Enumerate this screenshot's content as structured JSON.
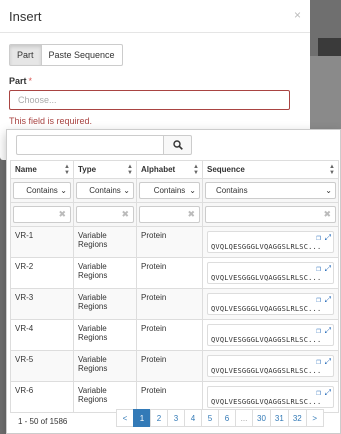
{
  "modal": {
    "title": "Insert",
    "close": "×",
    "mode_buttons": [
      "Part",
      "Paste Sequence"
    ],
    "field_label": "Part",
    "required_mark": "*",
    "placeholder": "Choose...",
    "error": "This field is required."
  },
  "table": {
    "columns": [
      "Name",
      "Type",
      "Alphabet",
      "Sequence"
    ],
    "filter_options": [
      "Contains",
      "Contains",
      "Contains",
      "Contains"
    ],
    "rows": [
      {
        "name": "VR-1",
        "type": "Variable Regions",
        "alphabet": "Protein",
        "sequence": "QVQLQESGGGLVQAGGSLRLSC..."
      },
      {
        "name": "VR-2",
        "type": "Variable Regions",
        "alphabet": "Protein",
        "sequence": "QVQLVESGGGLVQAGGSLRLSC..."
      },
      {
        "name": "VR-3",
        "type": "Variable Regions",
        "alphabet": "Protein",
        "sequence": "QVQLVESGGGLVQAGGSLRLSC..."
      },
      {
        "name": "VR-4",
        "type": "Variable Regions",
        "alphabet": "Protein",
        "sequence": "QVQLVESGGGLVQAGGSLRLSC..."
      },
      {
        "name": "VR-5",
        "type": "Variable Regions",
        "alphabet": "Protein",
        "sequence": "QVQLVESGGGLVQAGGSLRLSC..."
      },
      {
        "name": "VR-6",
        "type": "Variable Regions",
        "alphabet": "Protein",
        "sequence": "QVQLVESGGGLVQAGGSLRLSC..."
      }
    ]
  },
  "pagination": {
    "info": "1 - 50 of 1586",
    "pages": [
      "<",
      "1",
      "2",
      "3",
      "4",
      "5",
      "6",
      "...",
      "30",
      "31",
      "32",
      ">"
    ],
    "active": "1"
  },
  "icons": {
    "search": "search-icon",
    "copy": "copy-icon",
    "expand": "expand-icon",
    "clear": "clear-icon",
    "sort": "sort-icon"
  },
  "colors": {
    "primary": "#337ab7",
    "error": "#a94442"
  }
}
